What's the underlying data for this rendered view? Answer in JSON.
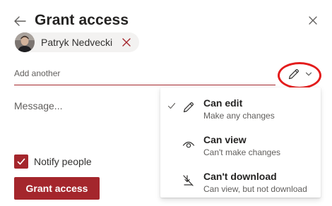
{
  "header": {
    "title": "Grant access"
  },
  "recipients": [
    {
      "name": "Patryk Nedvecki"
    }
  ],
  "add_input": {
    "placeholder": "Add another",
    "value": ""
  },
  "message": {
    "placeholder": "Message...",
    "value": ""
  },
  "notify": {
    "label": "Notify people",
    "checked": true
  },
  "primary_button": {
    "label": "Grant access"
  },
  "permissions_menu": {
    "items": [
      {
        "title": "Can edit",
        "description": "Make any changes",
        "icon": "pencil-icon",
        "selected": true
      },
      {
        "title": "Can view",
        "description": "Can't make changes",
        "icon": "eye-icon",
        "selected": false
      },
      {
        "title": "Can't download",
        "description": "Can view, but not download",
        "icon": "no-download-icon",
        "selected": false
      }
    ]
  },
  "colors": {
    "accent": "#a4262c",
    "annotation": "#e31c1c",
    "text_primary": "#252423",
    "text_secondary": "#605e5c",
    "chip_background": "#f3f2f1"
  }
}
